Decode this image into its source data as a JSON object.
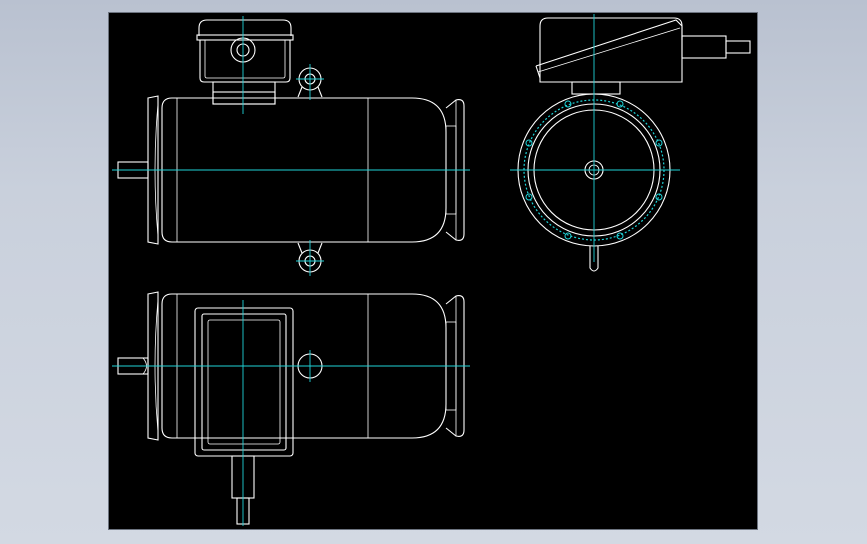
{
  "viewport": {
    "background_top": "#b9c1d0",
    "background_bottom": "#d3d9e3",
    "sheet_color": "#000000"
  },
  "colors": {
    "outline": "#ffffff",
    "centerline": "#1fd3d8"
  },
  "views": [
    {
      "name": "front-view"
    },
    {
      "name": "top-view"
    },
    {
      "name": "side-view"
    }
  ]
}
